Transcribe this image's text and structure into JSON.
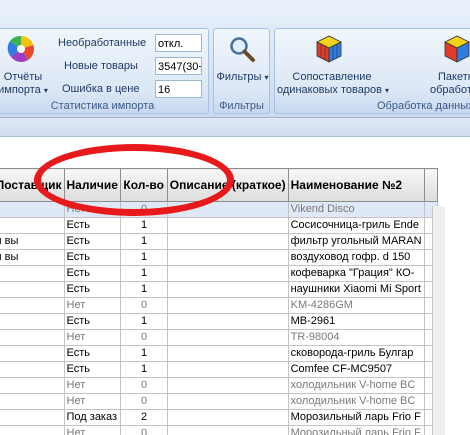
{
  "ribbon": {
    "groups": {
      "import_stats": {
        "label": "Статистика импорта",
        "reports_button": {
          "line1": "Отчёты",
          "line2": "импорта"
        },
        "fields": [
          {
            "label": "Необработанные",
            "value": "откл."
          },
          {
            "label": "Новые товары",
            "value": "3547(30+"
          },
          {
            "label": "Ошибка в цене",
            "value": "16"
          }
        ]
      },
      "filters": {
        "label": "Фильтры",
        "filters_button": "Фильтры"
      },
      "data_processing": {
        "label": "Обработка данных",
        "compare_button": {
          "line1": "Сопоставление",
          "line2": "одинаковых товаров"
        },
        "batch_button": {
          "line1": "Пакетн",
          "line2": "обработка д"
        }
      }
    }
  },
  "table": {
    "columns": [
      "Поставщик",
      "Наличие",
      "Кол-во",
      "Описание (краткое)",
      "Наименование №2"
    ],
    "rows": [
      {
        "supplier": "",
        "availability": "Нет",
        "qty": "0",
        "description": "",
        "name2": "Vikend Disco",
        "grey": true,
        "selected": true
      },
      {
        "supplier": "",
        "availability": "Есть",
        "qty": "1",
        "description": "",
        "name2": "Сосисочница-гриль  Ende",
        "grey": false,
        "selected": false
      },
      {
        "supplier": "я вы",
        "availability": "Есть",
        "qty": "1",
        "description": "",
        "name2": "фильтр угольный MARAN",
        "grey": false,
        "selected": false
      },
      {
        "supplier": "я вы",
        "availability": "Есть",
        "qty": "1",
        "description": "",
        "name2": "воздуховод гофр. d 150",
        "grey": false,
        "selected": false
      },
      {
        "supplier": "",
        "availability": "Есть",
        "qty": "1",
        "description": "",
        "name2": "кофеварка \"Грация\" КО-",
        "grey": false,
        "selected": false
      },
      {
        "supplier": "",
        "availability": "Есть",
        "qty": "1",
        "description": "",
        "name2": "наушники Xiaomi Mi Sport",
        "grey": false,
        "selected": false
      },
      {
        "supplier": "",
        "availability": "Нет",
        "qty": "0",
        "description": "",
        "name2": "KM-4286GM",
        "grey": true,
        "selected": false
      },
      {
        "supplier": "",
        "availability": "Есть",
        "qty": "1",
        "description": "",
        "name2": "MB-2961",
        "grey": false,
        "selected": false
      },
      {
        "supplier": "",
        "availability": "Нет",
        "qty": "0",
        "description": "",
        "name2": "TR-98004",
        "grey": true,
        "selected": false
      },
      {
        "supplier": "",
        "availability": "Есть",
        "qty": "1",
        "description": "",
        "name2": "сковорода-гриль Булгар",
        "grey": false,
        "selected": false
      },
      {
        "supplier": "",
        "availability": "Есть",
        "qty": "1",
        "description": "",
        "name2": "Comfee CF-MC9507",
        "grey": false,
        "selected": false
      },
      {
        "supplier": "",
        "availability": "Нет",
        "qty": "0",
        "description": "",
        "name2": "холодильник V-home  BC",
        "grey": true,
        "selected": false
      },
      {
        "supplier": "",
        "availability": "Нет",
        "qty": "0",
        "description": "",
        "name2": "холодильник V-home  BC",
        "grey": true,
        "selected": false
      },
      {
        "supplier": "",
        "availability": "Под заказ",
        "qty": "2",
        "description": "",
        "name2": "Морозильный ларь Frio F",
        "grey": false,
        "selected": false
      },
      {
        "supplier": "",
        "availability": "Нет",
        "qty": "0",
        "description": "",
        "name2": "Морозильный ларь Frio F",
        "grey": true,
        "selected": false
      }
    ]
  },
  "colors": {
    "annotation": "#e8191a",
    "ribbon_text": "#1e3a66",
    "group_label": "#3b5a88"
  }
}
